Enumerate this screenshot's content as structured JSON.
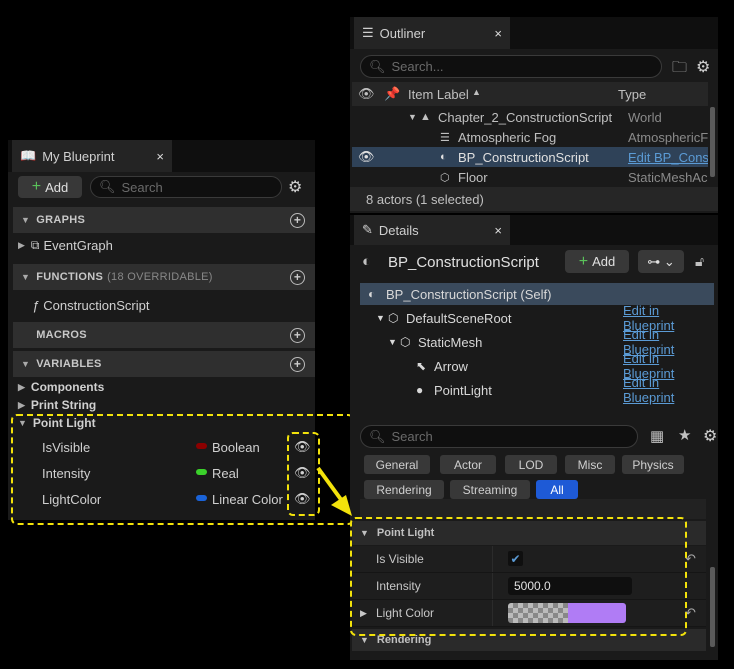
{
  "blueprint_panel": {
    "tab_title": "My Blueprint",
    "close": "×",
    "add_label": "Add",
    "search_placeholder": "Search",
    "graphs_label": "GRAPHS",
    "event_graph": "EventGraph",
    "functions_label": "FUNCTIONS",
    "functions_sub": "(18 OVERRIDABLE)",
    "construction_script": "ConstructionScript",
    "macros_label": "MACROS",
    "variables_label": "VARIABLES",
    "components": "Components",
    "print_string": "Print String",
    "point_light": "Point Light",
    "variables": [
      {
        "name": "IsVisible",
        "type": "Boolean",
        "color": "#8b0000"
      },
      {
        "name": "Intensity",
        "type": "Real",
        "color": "#3bd12b"
      },
      {
        "name": "LightColor",
        "type": "Linear Color",
        "color": "#1a63d8"
      }
    ]
  },
  "outliner": {
    "tab_title": "Outliner",
    "close": "×",
    "search_placeholder": "Search...",
    "col_label": "Item Label",
    "col_type": "Type",
    "rows": [
      {
        "label": "Chapter_2_ConstructionScript",
        "type": "World"
      },
      {
        "label": "Atmospheric Fog",
        "type": "AtmosphericF"
      },
      {
        "label": "BP_ConstructionScript",
        "type": "Edit BP_Const"
      },
      {
        "label": "Floor",
        "type": "StaticMeshAc"
      }
    ],
    "status": "8 actors (1 selected)"
  },
  "details": {
    "tab_title": "Details",
    "close": "×",
    "object_name": "BP_ConstructionScript",
    "add_label": "Add",
    "components": [
      {
        "label": "BP_ConstructionScript (Self)",
        "link": ""
      },
      {
        "label": "DefaultSceneRoot",
        "link": "Edit in Blueprint"
      },
      {
        "label": "StaticMesh",
        "link": "Edit in Blueprint"
      },
      {
        "label": "Arrow",
        "link": "Edit in Blueprint"
      },
      {
        "label": "PointLight",
        "link": "Edit in Blueprint"
      }
    ],
    "search_placeholder": "Search",
    "filters_row1": [
      "General",
      "Actor",
      "LOD",
      "Misc",
      "Physics"
    ],
    "filters_row2": [
      "Rendering",
      "Streaming",
      "All"
    ],
    "point_light_section": "Point Light",
    "props": [
      {
        "label": "Is Visible",
        "value": "✔"
      },
      {
        "label": "Intensity",
        "value": "5000.0"
      },
      {
        "label": "Light Color",
        "value": ""
      }
    ],
    "light_color": "#b07cf5",
    "rendering_section": "Rendering"
  },
  "colors": {
    "highlight": "#f2e20b",
    "link": "#5b9bd5",
    "selected": "#2f4258",
    "toggle_on": "#1e5ad6"
  }
}
